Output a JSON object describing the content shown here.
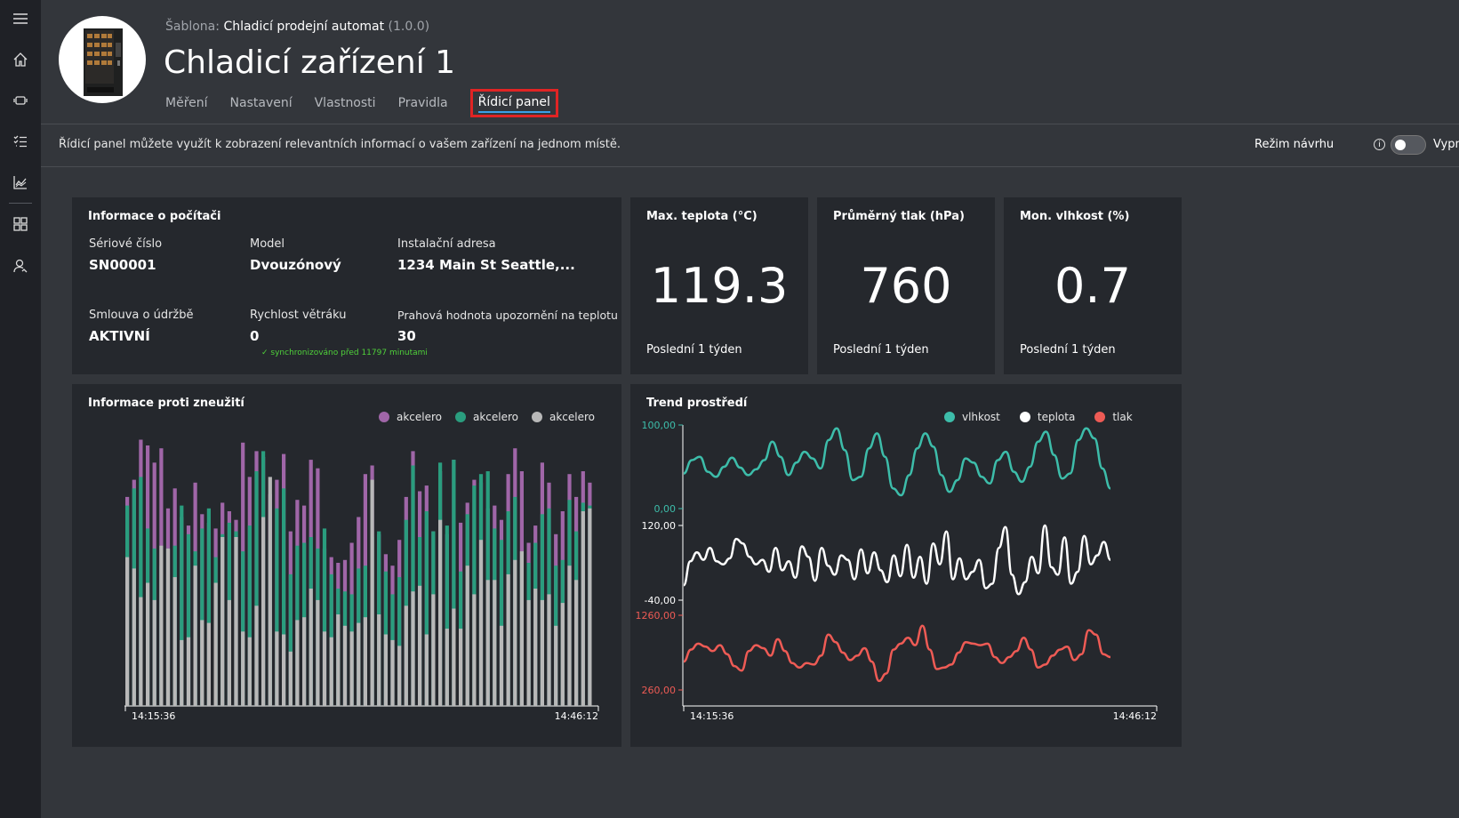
{
  "nav": {
    "icons": [
      "menu-icon",
      "home-icon",
      "device-icon",
      "rules-icon",
      "analytics-icon",
      "dashboard-icon",
      "user-icon"
    ]
  },
  "header": {
    "template_label": "Šablona:",
    "template_name": "Chladicí prodejní automat",
    "template_version": "(1.0.0)",
    "title": "Chladicí zařízení 1",
    "tabs": [
      "Měření",
      "Nastavení",
      "Vlastnosti",
      "Pravidla",
      "Řídicí panel"
    ],
    "active_tab": "Řídicí panel"
  },
  "infobar": {
    "description": "Řídicí panel můžete využít k zobrazení relevantních informací o vašem zařízení na jednom místě.",
    "design_mode_label": "Režim návrhu",
    "toggle_label": "Vypnout"
  },
  "info_card": {
    "title": "Informace o počítači",
    "serial_label": "Sériové číslo",
    "serial_value": "SN00001",
    "model_label": "Model",
    "model_value": "Dvouzónový",
    "address_label": "Instalační adresa",
    "address_value": "1234 Main St Seattle,...",
    "contract_label": "Smlouva o údržbě",
    "contract_value": "AKTIVNÍ",
    "fan_label": "Rychlost větráku",
    "fan_value": "0",
    "threshold_label": "Prahová hodnota upozornění na teplotu",
    "threshold_value": "30",
    "sync_text": "✓ synchronizováno před 11797 minutami"
  },
  "kpis": [
    {
      "title": "Max. teplota (°C)",
      "value": "119.3",
      "footer": "Poslední 1 týden"
    },
    {
      "title": "Průměrný tlak (hPa)",
      "value": "760",
      "footer": "Poslední 1 týden"
    },
    {
      "title": "Mon. vlhkost (%)",
      "value": "0.7",
      "footer": "Poslední 1 týden"
    }
  ],
  "colors": {
    "purple": "#a066a8",
    "teal": "#2a9d7e",
    "gray": "#b8b8b8",
    "humidity": "#3dbdaa",
    "temperature": "#ffffff",
    "pressure": "#ee5b55"
  },
  "chart_data": [
    {
      "type": "bar",
      "title": "Informace proti zneužití",
      "x_start": "14:15:36",
      "x_end": "14:46:12",
      "series": [
        {
          "name": "akcelerom",
          "values": [
            73,
            79,
            93,
            91,
            85,
            90,
            69,
            76,
            66,
            63,
            78,
            67,
            64,
            62,
            71,
            68,
            65,
            92,
            80,
            89,
            87,
            74,
            79,
            88,
            61,
            72,
            70,
            86,
            83,
            55,
            52,
            50,
            51,
            57,
            66,
            81,
            84,
            60,
            53,
            49,
            58,
            73,
            89,
            75,
            77,
            61,
            82,
            60,
            86,
            64,
            71,
            79,
            78,
            69,
            70,
            65,
            81,
            90,
            82,
            57,
            63,
            85,
            78,
            60,
            68,
            81,
            73,
            82,
            78
          ]
        },
        {
          "name": "akcelerom",
          "values": [
            70,
            76,
            80,
            62,
            55,
            49,
            55,
            56,
            70,
            60,
            54,
            62,
            69,
            52,
            60,
            64,
            61,
            54,
            63,
            82,
            89,
            58,
            69,
            76,
            46,
            56,
            57,
            59,
            55,
            62,
            46,
            41,
            40,
            39,
            48,
            49,
            59,
            61,
            47,
            39,
            45,
            65,
            84,
            59,
            68,
            61,
            85,
            63,
            86,
            47,
            67,
            77,
            81,
            82,
            62,
            58,
            68,
            73,
            51,
            50,
            57,
            67,
            69,
            49,
            51,
            72,
            61,
            71,
            70
          ]
        },
        {
          "name": "akcelerom",
          "values": [
            52,
            48,
            38,
            43,
            37,
            56,
            55,
            45,
            23,
            24,
            49,
            30,
            29,
            43,
            59,
            37,
            59,
            26,
            24,
            35,
            66,
            80,
            26,
            25,
            19,
            30,
            31,
            41,
            37,
            26,
            24,
            32,
            28,
            26,
            29,
            31,
            79,
            32,
            25,
            23,
            21,
            35,
            40,
            42,
            25,
            39,
            65,
            27,
            34,
            27,
            49,
            39,
            58,
            44,
            44,
            28,
            46,
            51,
            54,
            37,
            41,
            37,
            39,
            28,
            36,
            49,
            44,
            68,
            69
          ]
        }
      ]
    },
    {
      "type": "line",
      "title": "Trend prostředí",
      "x_start": "14:15:36",
      "x_end": "14:46:12",
      "series": [
        {
          "name": "vlhkost",
          "ylim": [
            0,
            100
          ],
          "y_ticks": [
            "100,00",
            "0,00"
          ],
          "values": [
            42,
            58,
            62,
            44,
            38,
            50,
            61,
            49,
            40,
            47,
            58,
            80,
            62,
            40,
            55,
            68,
            60,
            48,
            82,
            96,
            70,
            34,
            38,
            72,
            90,
            62,
            24,
            16,
            40,
            72,
            90,
            74,
            40,
            20,
            34,
            60,
            55,
            38,
            30,
            58,
            68,
            44,
            32,
            50,
            80,
            92,
            64,
            36,
            42,
            82,
            96,
            84,
            48,
            24
          ]
        },
        {
          "name": "teplota",
          "ylim": [
            -40,
            120
          ],
          "y_ticks": [
            "120,00",
            "-40,00"
          ],
          "values": [
            20,
            52,
            64,
            54,
            70,
            52,
            48,
            56,
            82,
            76,
            58,
            48,
            54,
            38,
            70,
            40,
            52,
            30,
            72,
            58,
            26,
            70,
            46,
            34,
            60,
            54,
            28,
            68,
            36,
            64,
            40,
            24,
            60,
            32,
            74,
            30,
            58,
            22,
            76,
            48,
            92,
            28,
            56,
            28,
            38,
            54,
            16,
            22,
            70,
            98,
            34,
            8,
            24,
            58,
            36,
            100,
            44,
            34,
            84,
            22,
            38,
            86,
            48,
            60,
            78,
            54
          ]
        },
        {
          "name": "tlak",
          "ylim": [
            260,
            1260
          ],
          "y_ticks": [
            "1260,00",
            "260,00"
          ],
          "values": [
            38,
            54,
            62,
            58,
            52,
            60,
            48,
            32,
            26,
            52,
            60,
            56,
            46,
            68,
            52,
            36,
            30,
            36,
            34,
            46,
            74,
            64,
            50,
            40,
            46,
            56,
            38,
            12,
            22,
            54,
            62,
            70,
            60,
            86,
            54,
            28,
            30,
            34,
            50,
            64,
            62,
            60,
            62,
            44,
            36,
            44,
            52,
            70,
            54,
            30,
            34,
            46,
            54,
            58,
            40,
            48,
            80,
            74,
            48,
            44
          ]
        }
      ]
    }
  ]
}
